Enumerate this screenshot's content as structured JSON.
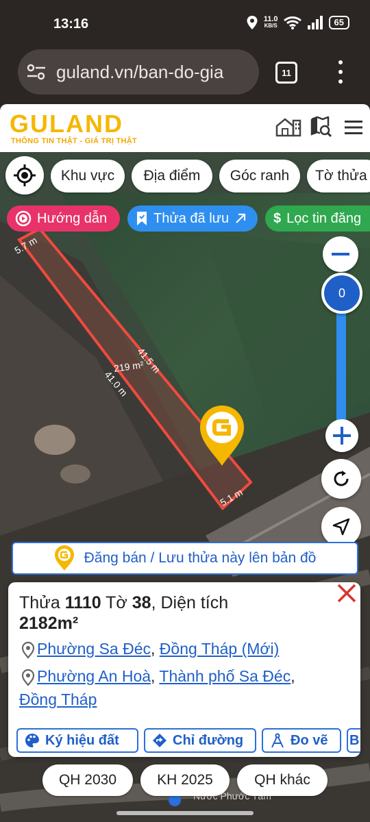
{
  "status_bar": {
    "time": "13:16",
    "speed_value": "11.0",
    "speed_unit": "KB/S",
    "battery": "65"
  },
  "browser": {
    "url": "guland.vn/ban-do-gia",
    "tab_count": "11"
  },
  "site": {
    "logo": "GULAND",
    "slogan": "THÔNG TIN THẬT - GIÁ TRỊ THẬT",
    "brand_color": "#f5b700"
  },
  "filter_chips": [
    "Khu vực",
    "Địa điểm",
    "Góc ranh",
    "Tờ thửa"
  ],
  "action_pills": {
    "guide": "Hướng dẫn",
    "saved": "Thửa đã lưu",
    "filter": "Lọc tin đăng"
  },
  "parcel_labels": {
    "top": "5.7 m",
    "right": "41.5 m",
    "left": "41.0 m",
    "bottom": "5.1 m",
    "area": "219 m²"
  },
  "zoom_controls": {
    "level": "0"
  },
  "banner": {
    "text": "Đăng bán / Lưu thửa này lên bản đồ"
  },
  "info_card": {
    "title_prefix": "Thửa",
    "parcel_number": "1110",
    "sheet_label": "Tờ",
    "sheet_number": "38",
    "area_label": ", Diện tích",
    "area_value": "2182m²",
    "address_new_ward": "Phường Sa Đéc",
    "address_new_province": "Đồng Tháp (Mới)",
    "address_old_ward": "Phường An Hoà",
    "address_old_city": "Thành phố Sa Đéc",
    "address_old_province": "Đồng Tháp",
    "buttons": [
      "Ký hiệu đất",
      "Chỉ đường",
      "Đo vẽ",
      "B"
    ]
  },
  "bottom_chips": [
    "QH 2030",
    "KH 2025",
    "QH khác"
  ],
  "map_text": {
    "place_fragment": "Nước Phước Tâm"
  },
  "colors": {
    "accent_blue": "#1f5fc8",
    "guide_pink": "#e8336a",
    "saved_blue": "#2f8ff0",
    "filter_green": "#2fa84f",
    "parcel_red": "#f04b3e",
    "close_red": "#d9342b"
  }
}
